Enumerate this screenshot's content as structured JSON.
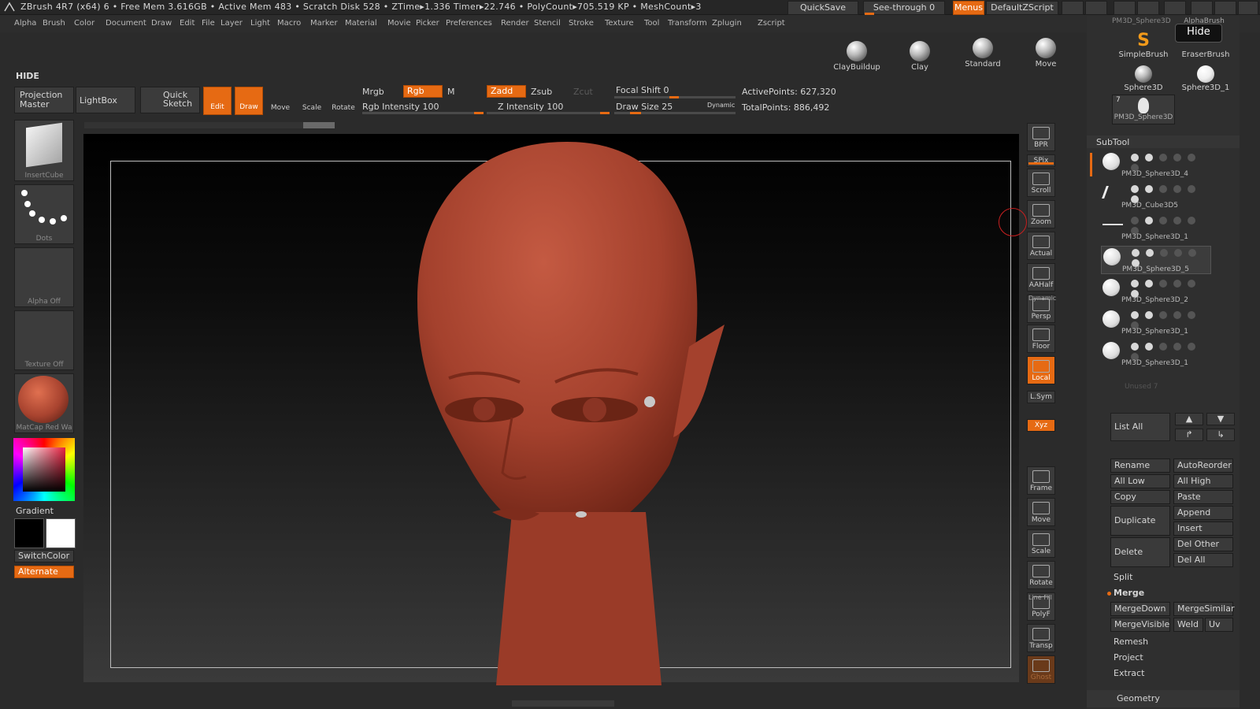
{
  "titlebar": {
    "text": "ZBrush 4R7 (x64)    6    • Free Mem 3.616GB • Active Mem 483 • Scratch Disk 528 •  ZTime▸1.336 Timer▸22.746 • PolyCount▸705.519 KP  • MeshCount▸3",
    "quicksave": "QuickSave",
    "seethrough": "See-through   0",
    "menus": "Menus",
    "defaultzscript": "DefaultZScript"
  },
  "menubar": [
    "Alpha",
    "Brush",
    "Color",
    "Document",
    "Draw",
    "Edit",
    "File",
    "Layer",
    "Light",
    "Macro",
    "Marker",
    "Material",
    "Movie",
    "Picker",
    "Preferences",
    "Render",
    "Stencil",
    "Stroke",
    "Texture",
    "Tool",
    "Transform",
    "Zplugin",
    "Zscript"
  ],
  "shelf_brushes": [
    "ClayBuildup",
    "Clay",
    "Standard",
    "Move"
  ],
  "hide_label": "HIDE",
  "toolbar": {
    "projection_master": "Projection Master",
    "lightbox": "LightBox",
    "quick_sketch": "Quick Sketch",
    "edit": "Edit",
    "draw": "Draw",
    "move": "Move",
    "scale": "Scale",
    "rotate": "Rotate",
    "mrgb": "Mrgb",
    "rgb": "Rgb",
    "m": "M",
    "rgb_intensity": "Rgb Intensity 100",
    "zadd": "Zadd",
    "zsub": "Zsub",
    "zcut": "Zcut",
    "z_intensity": "Z Intensity 100",
    "focal_shift": "Focal Shift 0",
    "draw_size": "Draw Size 25",
    "dynamic": "Dynamic",
    "active_points": "ActivePoints: 627,320",
    "total_points": "TotalPoints: 886,492"
  },
  "left": {
    "insertcube": "InsertCube",
    "dots": "Dots",
    "alpha_off": "Alpha Off",
    "texture_off": "Texture Off",
    "matcap": "MatCap Red Wa",
    "gradient": "Gradient",
    "switchcolor": "SwitchColor",
    "alternate": "Alternate"
  },
  "right_toolbar": [
    "BPR",
    "SPix",
    "Scroll",
    "Zoom",
    "Actual",
    "AAHalf",
    "Persp",
    "Floor",
    "Local",
    "L.Sym",
    "Xyz",
    "Frame",
    "Move",
    "Scale",
    "Rotate",
    "PolyF",
    "Transp",
    "Ghost"
  ],
  "right_toolbar_small": {
    "dynamic": "Dynamic",
    "line_fill": "Line Fill"
  },
  "tool_palette": {
    "top_item": "PM3D_Sphere3D",
    "hide_tooltip": "Hide",
    "alphabrush": "AlphaBrush",
    "simplebrush": "SimpleBrush",
    "eraserbrush": "EraserBrush",
    "sphere3d": "Sphere3D",
    "sphere3d_1": "Sphere3D_1",
    "pm3d_sphere3d": "PM3D_Sphere3D",
    "count": "7"
  },
  "subtool": {
    "title": "SubTool",
    "items": [
      "PM3D_Sphere3D_4",
      "PM3D_Cube3D5",
      "PM3D_Sphere3D_1",
      "PM3D_Sphere3D_5",
      "PM3D_Sphere3D_2",
      "PM3D_Sphere3D_1",
      "PM3D_Sphere3D_1"
    ],
    "unused": "Unused 7",
    "list_all": "List All",
    "rename": "Rename",
    "autoreorder": "AutoReorder",
    "all_low": "All Low",
    "all_high": "All High",
    "copy": "Copy",
    "paste": "Paste",
    "duplicate": "Duplicate",
    "append": "Append",
    "insert": "Insert",
    "delete": "Delete",
    "del_other": "Del Other",
    "del_all": "Del All",
    "split": "Split",
    "merge": "Merge",
    "mergedown": "MergeDown",
    "mergesimilar": "MergeSimilar",
    "mergevisible": "MergeVisible",
    "weld": "Weld",
    "uv": "Uv",
    "remesh": "Remesh",
    "project": "Project",
    "extract": "Extract",
    "geometry": "Geometry"
  },
  "colors": {
    "accent": "#e66a13",
    "clay": "#a8432f",
    "bg": "#2b2b2b"
  }
}
